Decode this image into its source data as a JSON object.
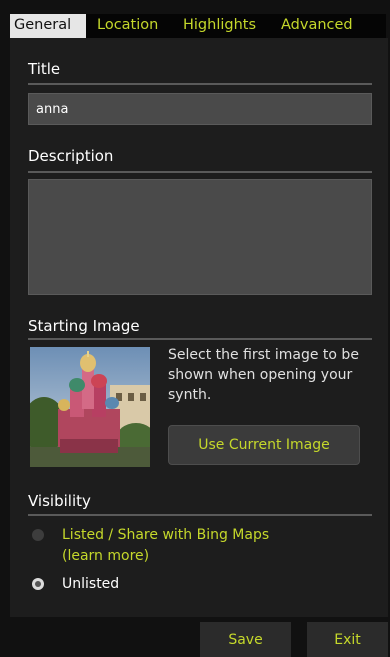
{
  "tabs": [
    {
      "label": "General",
      "active": true
    },
    {
      "label": "Location",
      "active": false
    },
    {
      "label": "Highlights",
      "active": false
    },
    {
      "label": "Advanced",
      "active": false
    }
  ],
  "title_section": {
    "label": "Title",
    "value": "anna"
  },
  "description_section": {
    "label": "Description",
    "value": ""
  },
  "starting_image": {
    "label": "Starting Image",
    "hint": "Select the first image to be shown when opening your synth.",
    "button_label": "Use Current Image"
  },
  "visibility": {
    "label": "Visibility",
    "options": [
      {
        "label": "Listed / Share with Bing Maps",
        "selected": false
      },
      {
        "label": "Unlisted",
        "selected": true
      }
    ],
    "learn_more": "(learn more)"
  },
  "footer": {
    "save_label": "Save",
    "exit_label": "Exit"
  },
  "colors": {
    "accent": "#c5d82b",
    "panel": "#1d1d1d",
    "field": "#4a4a4a",
    "active_tab": "#e6e6e6"
  }
}
